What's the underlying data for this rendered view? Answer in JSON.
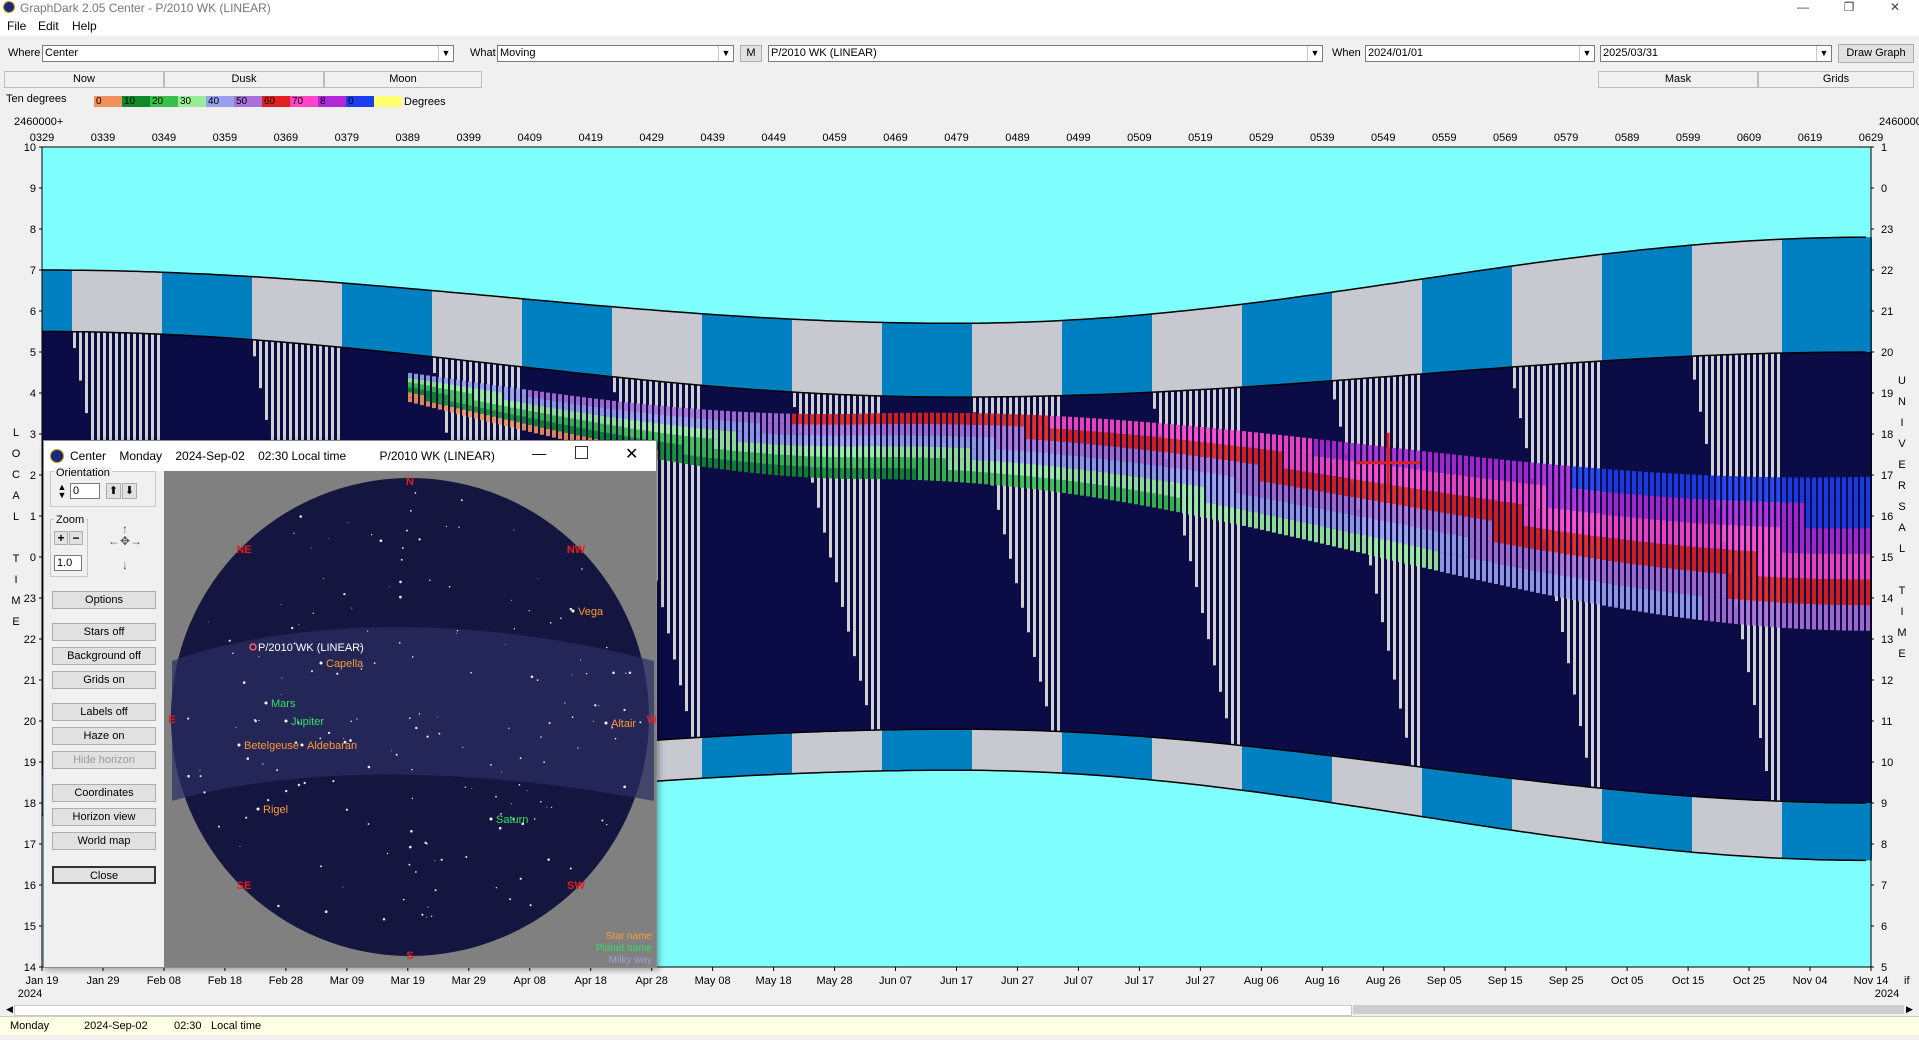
{
  "window": {
    "title": "GraphDark 2.05  Center  -  P/2010 WK (LINEAR)",
    "minimize": "—",
    "restore": "❐",
    "close": "✕"
  },
  "menu": {
    "items": [
      "File",
      "Edit",
      "Help"
    ]
  },
  "toolbar": {
    "where_label": "Where",
    "where_value": "Center",
    "what_label": "What",
    "what_value": "Moving",
    "m_button": "M",
    "object_value": "P/2010 WK (LINEAR)",
    "when_label": "When",
    "date_from": "2024/01/01",
    "date_to": "2025/03/31",
    "draw_button": "Draw Graph",
    "tabs": [
      "Now",
      "Dusk",
      "Moon",
      "Mask",
      "Grids"
    ]
  },
  "legend": {
    "label": "Ten degrees",
    "unit": "Degrees",
    "bins": [
      {
        "label": "0",
        "color": "#f0905a"
      },
      {
        "label": "10",
        "color": "#0f8a2a"
      },
      {
        "label": "20",
        "color": "#37c04a"
      },
      {
        "label": "30",
        "color": "#98ee98"
      },
      {
        "label": "40",
        "color": "#98a0ee"
      },
      {
        "label": "50",
        "color": "#a870d8"
      },
      {
        "label": "60",
        "color": "#e22020"
      },
      {
        "label": "70",
        "color": "#ff44c8"
      },
      {
        "label": "8",
        "color": "#b028d8"
      },
      {
        "label": "0",
        "color": "#1a3ef0"
      },
      {
        "label": "",
        "color": "#ffff70"
      }
    ]
  },
  "chart": {
    "jd_prefix": "2460000+",
    "top_ticks": [
      "0329",
      "0339",
      "0349",
      "0359",
      "0369",
      "0379",
      "0389",
      "0399",
      "0409",
      "0419",
      "0429",
      "0439",
      "0449",
      "0459",
      "0469",
      "0479",
      "0489",
      "0499",
      "0509",
      "0519",
      "0529",
      "0539",
      "0549",
      "0559",
      "0569",
      "0579",
      "0589",
      "0599",
      "0609",
      "0619",
      "0629"
    ],
    "bottom_ticks": [
      "Jan 19",
      "Jan 29",
      "Feb 08",
      "Feb 18",
      "Feb 28",
      "Mar 09",
      "Mar 19",
      "Mar 29",
      "Apr 08",
      "Apr 18",
      "Apr 28",
      "May 08",
      "May 18",
      "May 28",
      "Jun 07",
      "Jun 17",
      "Jun 27",
      "Jul 07",
      "Jul 17",
      "Jul 27",
      "Aug 06",
      "Aug 16",
      "Aug 26",
      "Sep 05",
      "Sep 15",
      "Sep 25",
      "Oct 05",
      "Oct 15",
      "Oct 25",
      "Nov 04",
      "Nov 14"
    ],
    "year_left": "2024",
    "year_right": "2024",
    "right_edge_label": "if",
    "left_axis_title": "LOCAL TIME",
    "right_axis_title": "UNIVERSAL TIME",
    "left_hours": [
      "10",
      "9",
      "8",
      "7",
      "6",
      "5",
      "4",
      "3",
      "2",
      "1",
      "0",
      "23",
      "22",
      "21",
      "20",
      "19",
      "18",
      "17",
      "16",
      "15",
      "14"
    ],
    "right_hours": [
      "1",
      "0",
      "23",
      "22",
      "21",
      "20",
      "19",
      "18",
      "17",
      "16",
      "15",
      "14",
      "13",
      "12",
      "11",
      "10",
      "9",
      "8",
      "7",
      "6",
      "5"
    ],
    "colors": {
      "background": "#80ffff",
      "night": "#0b0b46",
      "twilight": "#0080c0",
      "moon": "#d0d0d0",
      "cursor": "#e02020"
    }
  },
  "dialog": {
    "title": "Center    Monday    2024-Sep-02    02:30 Local time          P/2010 WK (LINEAR)",
    "orientation_label": "Orientation",
    "orientation_value": "0",
    "zoom_label": "Zoom",
    "zoom_value": "1.0",
    "buttons": [
      "Options",
      "Stars off",
      "Background off",
      "Grids on",
      "Labels off",
      "Haze on",
      "Hide horizon",
      "Coordinates",
      "Horizon view",
      "World map",
      "Close"
    ],
    "compass": [
      "N",
      "NE",
      "NW",
      "E",
      "W",
      "SE",
      "SW",
      "S"
    ],
    "labels": [
      {
        "text": "P/2010 WK (LINEAR)",
        "kind": "target"
      },
      {
        "text": "Capella",
        "kind": "star"
      },
      {
        "text": "Vega",
        "kind": "star"
      },
      {
        "text": "Mars",
        "kind": "planet"
      },
      {
        "text": "Jupiter",
        "kind": "planet"
      },
      {
        "text": "Altair",
        "kind": "star"
      },
      {
        "text": "Betelgeuse",
        "kind": "star"
      },
      {
        "text": "Aldebaran",
        "kind": "star"
      },
      {
        "text": "Rigel",
        "kind": "star"
      },
      {
        "text": "Saturn",
        "kind": "planet"
      }
    ],
    "key": [
      "Star name",
      "Planet name",
      "Milky way"
    ]
  },
  "status": {
    "day": "Monday",
    "date": "2024-Sep-02",
    "time": "02:30",
    "zone": "Local time"
  }
}
